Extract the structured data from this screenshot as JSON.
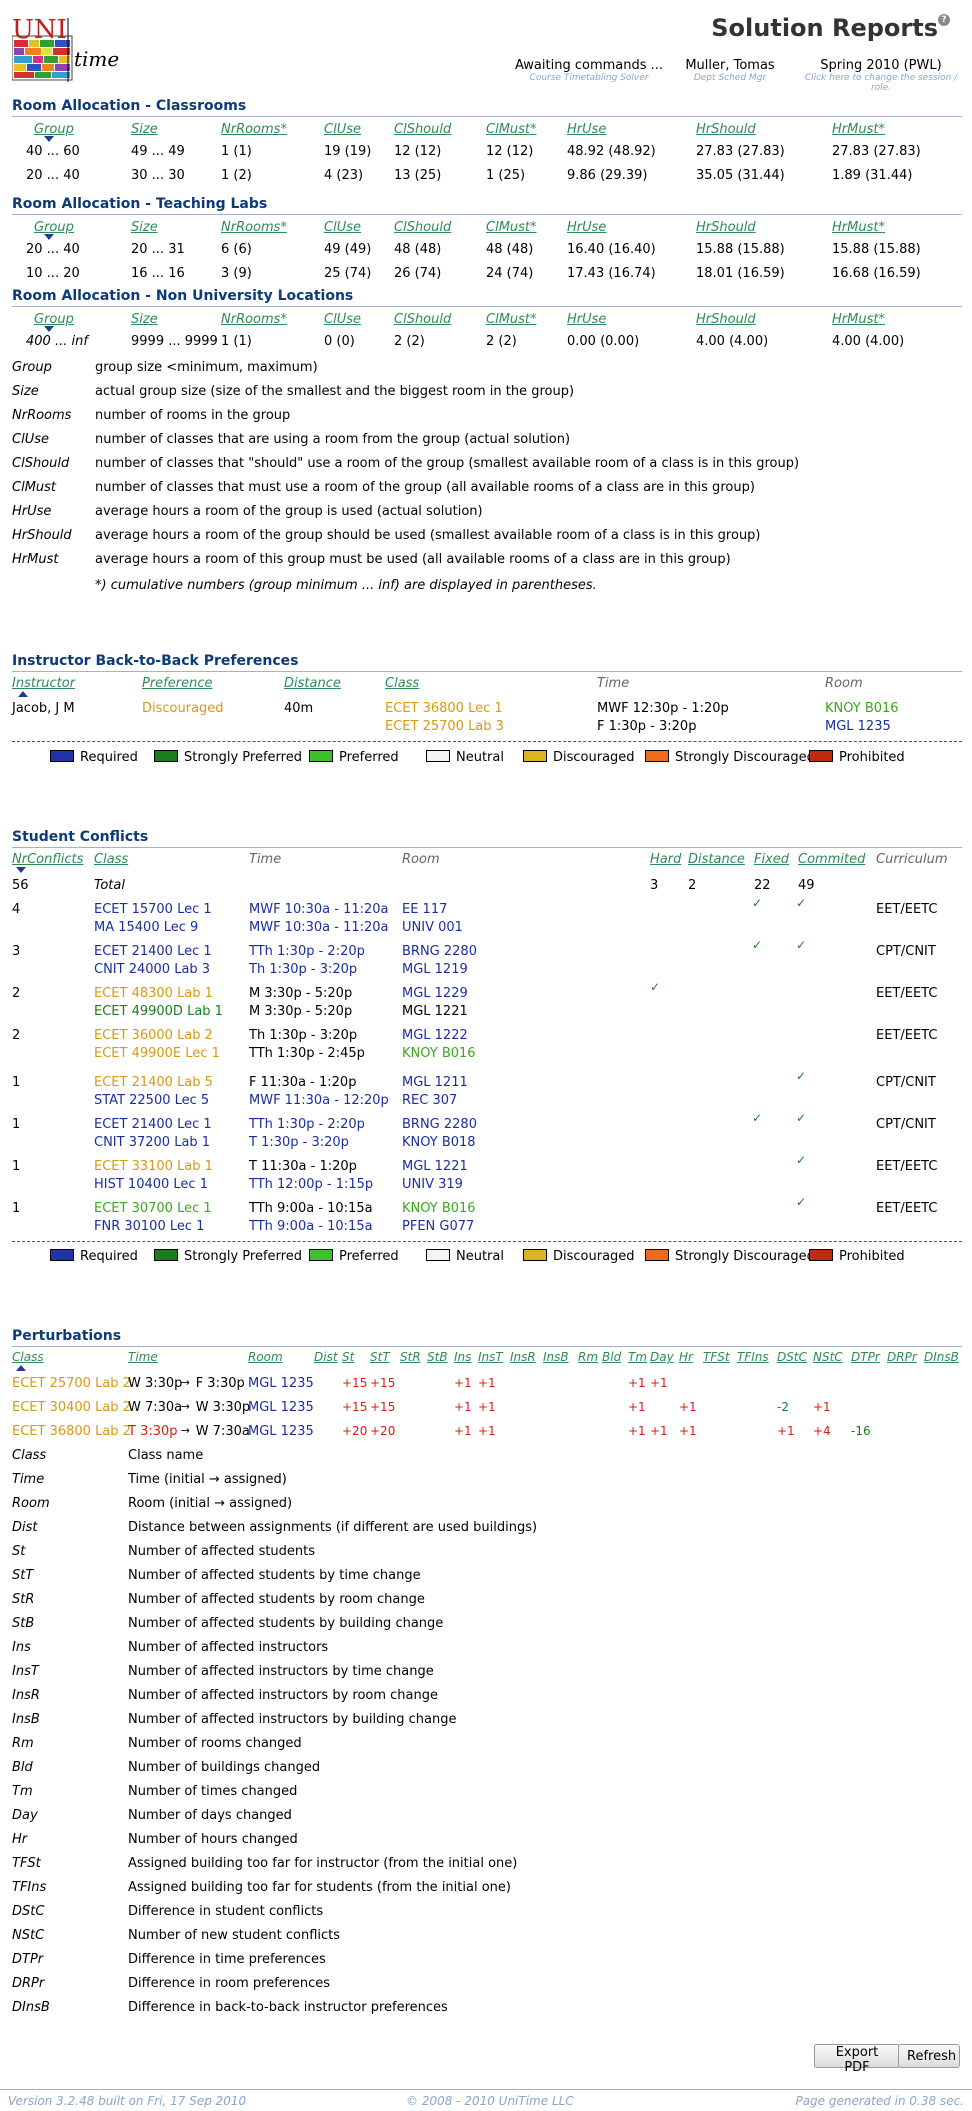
{
  "header": {
    "title": "Solution Reports",
    "logo_text_uni": "UNI",
    "logo_text_time": "time",
    "status": {
      "main": "Awaiting commands ...",
      "sub": "Course Timetabling Solver"
    },
    "user": {
      "main": "Muller, Tomas",
      "sub": "Dept Sched Mgr"
    },
    "session": {
      "main": "Spring 2010 (PWL)",
      "sub": "Click here to change the session / role."
    }
  },
  "room_columns": [
    "Group",
    "Size",
    "NrRooms*",
    "ClUse",
    "ClShould",
    "ClMust*",
    "HrUse",
    "HrShould",
    "HrMust*"
  ],
  "room_sections": [
    {
      "title": "Room Allocation - Classrooms",
      "rows": [
        [
          "40 ... 60",
          "49 ... 49",
          "1 (1)",
          "19 (19)",
          "12 (12)",
          "12 (12)",
          "48.92 (48.92)",
          "27.83 (27.83)",
          "27.83 (27.83)"
        ],
        [
          "20 ... 40",
          "30 ... 30",
          "1 (2)",
          "4 (23)",
          "13 (25)",
          "1 (25)",
          "9.86 (29.39)",
          "35.05 (31.44)",
          "1.89 (31.44)"
        ]
      ]
    },
    {
      "title": "Room Allocation - Teaching Labs",
      "rows": [
        [
          "20 ... 40",
          "20 ... 31",
          "6 (6)",
          "49 (49)",
          "48 (48)",
          "48 (48)",
          "16.40 (16.40)",
          "15.88 (15.88)",
          "15.88 (15.88)"
        ],
        [
          "10 ... 20",
          "16 ... 16",
          "3 (9)",
          "25 (74)",
          "26 (74)",
          "24 (74)",
          "17.43 (16.74)",
          "18.01 (16.59)",
          "16.68 (16.59)"
        ]
      ]
    },
    {
      "title": "Room Allocation - Non University Locations",
      "rows": [
        [
          "400 ... inf",
          "9999 ... 9999",
          "1 (1)",
          "0 (0)",
          "2 (2)",
          "2 (2)",
          "0.00 (0.00)",
          "4.00 (4.00)",
          "4.00 (4.00)"
        ]
      ]
    }
  ],
  "room_legend": [
    [
      "Group",
      "group size <minimum, maximum)"
    ],
    [
      "Size",
      "actual group size (size of the smallest and the biggest room in the group)"
    ],
    [
      "NrRooms",
      "number of rooms in the group"
    ],
    [
      "ClUse",
      "number of classes that are using a room from the group (actual solution)"
    ],
    [
      "ClShould",
      "number of classes that \"should\" use a room of the group (smallest available room of a class is in this group)"
    ],
    [
      "ClMust",
      "number of classes that must use a room of the group (all available rooms of a class are in this group)"
    ],
    [
      "HrUse",
      "average hours a room of the group is used (actual solution)"
    ],
    [
      "HrShould",
      "average hours a room of the group should be used (smallest available room of a class is in this group)"
    ],
    [
      "HrMust",
      "average hours a room of this group must be used (all available rooms of a class are in this group)"
    ]
  ],
  "room_note": "*) cumulative numbers (group minimum ... inf) are displayed in parentheses.",
  "instructor": {
    "title": "Instructor Back-to-Back Preferences",
    "columns": [
      "Instructor",
      "Preference",
      "Distance",
      "Class",
      "Time",
      "Room"
    ],
    "row": {
      "instructor": "Jacob, J M",
      "preference": "Discouraged",
      "distance": "40m",
      "classes": [
        "ECET 36800 Lec 1",
        "ECET 25700 Lab 3"
      ],
      "times": [
        "MWF 12:30p - 1:20p",
        "F 1:30p - 3:20p"
      ],
      "rooms": [
        "KNOY B016",
        "MGL 1235"
      ]
    }
  },
  "pref_legend": [
    {
      "label": "Required",
      "color": "#2233aa"
    },
    {
      "label": "Strongly Preferred",
      "color": "#1c7d1c"
    },
    {
      "label": "Preferred",
      "color": "#3cc02c"
    },
    {
      "label": "Neutral",
      "color": "#f4f4f4"
    },
    {
      "label": "Discouraged",
      "color": "#dcb422"
    },
    {
      "label": "Strongly Discouraged",
      "color": "#ee6a1c"
    },
    {
      "label": "Prohibited",
      "color": "#c02a10"
    }
  ],
  "student": {
    "title": "Student Conflicts",
    "columns": [
      "NrConflicts",
      "Class",
      "Time",
      "Room",
      "Hard",
      "Distance",
      "Fixed",
      "Commited",
      "Curriculum"
    ],
    "total": {
      "nr": "56",
      "label": "Total",
      "hard": "3",
      "distance": "2",
      "fixed": "22",
      "commited": "49"
    },
    "rows": [
      {
        "nr": "4",
        "c1": "ECET 15700 Lec 1",
        "c1c": "blue",
        "c2": "MA 15400 Lec 9",
        "c2c": "blue",
        "t1": "MWF 10:30a - 11:20a",
        "t1c": "blue",
        "t2": "MWF 10:30a - 11:20a",
        "t2c": "blue",
        "r1": "EE 117",
        "r1c": "blue",
        "r2": "UNIV 001",
        "r2c": "blue",
        "hard": "",
        "fixed": "✓",
        "commited": "✓",
        "curr": "EET/EETC"
      },
      {
        "nr": "3",
        "c1": "ECET 21400 Lec 1",
        "c1c": "blue",
        "c2": "CNIT 24000 Lab 3",
        "c2c": "blue",
        "t1": "TTh 1:30p - 2:20p",
        "t1c": "blue",
        "t2": "Th 1:30p - 3:20p",
        "t2c": "blue",
        "r1": "BRNG 2280",
        "r1c": "blue",
        "r2": "MGL 1219",
        "r2c": "blue",
        "hard": "",
        "fixed": "✓",
        "commited": "✓",
        "curr": "CPT/CNIT"
      },
      {
        "nr": "2",
        "c1": "ECET 48300 Lab 1",
        "c1c": "orange",
        "c2": "ECET 49900D Lab 1",
        "c2c": "green",
        "t1": "M 3:30p - 5:20p",
        "t1c": "",
        "t2": "M 3:30p - 5:20p",
        "t2c": "",
        "r1": "MGL 1229",
        "r1c": "blue",
        "r2": "MGL 1221",
        "r2c": "",
        "hard": "✓",
        "fixed": "",
        "commited": "",
        "curr": "EET/EETC"
      },
      {
        "nr": "2",
        "c1": "ECET 36000 Lab 2",
        "c1c": "orange",
        "c2": "ECET 49900E Lec 1",
        "c2c": "orange",
        "t1": "Th 1:30p - 3:20p",
        "t1c": "",
        "t2": "TTh 1:30p - 2:45p",
        "t2c": "",
        "r1": "MGL 1222",
        "r1c": "blue",
        "r2": "KNOY B016",
        "r2c": "lgreen",
        "hard": "",
        "fixed": "",
        "commited": "",
        "curr": "EET/EETC"
      },
      {
        "nr": "1",
        "c1": "ECET 21400 Lab 5",
        "c1c": "orange",
        "c2": "STAT 22500 Lec 5",
        "c2c": "blue",
        "t1": "F 11:30a - 1:20p",
        "t1c": "",
        "t2": "MWF 11:30a - 12:20p",
        "t2c": "blue",
        "r1": "MGL 1211",
        "r1c": "blue",
        "r2": "REC 307",
        "r2c": "blue",
        "hard": "",
        "fixed": "",
        "commited": "✓",
        "curr": "CPT/CNIT"
      },
      {
        "nr": "1",
        "c1": "ECET 21400 Lec 1",
        "c1c": "blue",
        "c2": "CNIT 37200 Lab 1",
        "c2c": "blue",
        "t1": "TTh 1:30p - 2:20p",
        "t1c": "blue",
        "t2": "T 1:30p - 3:20p",
        "t2c": "blue",
        "r1": "BRNG 2280",
        "r1c": "blue",
        "r2": "KNOY B018",
        "r2c": "blue",
        "hard": "",
        "fixed": "✓",
        "commited": "✓",
        "curr": "CPT/CNIT"
      },
      {
        "nr": "1",
        "c1": "ECET 33100 Lab 1",
        "c1c": "orange",
        "c2": "HIST 10400 Lec 1",
        "c2c": "blue",
        "t1": "T 11:30a - 1:20p",
        "t1c": "",
        "t2": "TTh 12:00p - 1:15p",
        "t2c": "blue",
        "r1": "MGL 1221",
        "r1c": "blue",
        "r2": "UNIV 319",
        "r2c": "blue",
        "hard": "",
        "fixed": "",
        "commited": "✓",
        "curr": "EET/EETC"
      },
      {
        "nr": "1",
        "c1": "ECET 30700 Lec 1",
        "c1c": "lgreen",
        "c2": "FNR 30100 Lec 1",
        "c2c": "blue",
        "t1": "TTh 9:00a - 10:15a",
        "t1c": "",
        "t2": "TTh 9:00a - 10:15a",
        "t2c": "blue",
        "r1": "KNOY B016",
        "r1c": "lgreen",
        "r2": "PFEN G077",
        "r2c": "blue",
        "hard": "",
        "fixed": "",
        "commited": "✓",
        "curr": "EET/EETC"
      }
    ]
  },
  "perturb": {
    "title": "Perturbations",
    "columns": [
      "Class",
      "Time",
      "Room",
      "Dist",
      "St",
      "StT",
      "StR",
      "StB",
      "Ins",
      "InsT",
      "InsR",
      "InsB",
      "Rm",
      "Bld",
      "Tm",
      "Day",
      "Hr",
      "TFSt",
      "TFIns",
      "DStC",
      "NStC",
      "DTPr",
      "DRPr",
      "DInsB"
    ],
    "rows": [
      {
        "cls": "ECET 25700 Lab 2",
        "t_from": "W 3:30p",
        "t_from_c": "",
        "t_to": "F 3:30p",
        "room": "MGL 1235",
        "vals": {
          "St": "+15",
          "StT": "+15",
          "Ins": "+1",
          "InsT": "+1",
          "Tm": "+1",
          "Day": "+1"
        }
      },
      {
        "cls": "ECET 30400 Lab 2",
        "t_from": "W 7:30a",
        "t_from_c": "",
        "t_to": "W 3:30p",
        "room": "MGL 1235",
        "vals": {
          "St": "+15",
          "StT": "+15",
          "Ins": "+1",
          "InsT": "+1",
          "Tm": "+1",
          "Hr": "+1",
          "DStC": "-2",
          "NStC": "+1"
        }
      },
      {
        "cls": "ECET 36800 Lab 2",
        "t_from": "T 3:30p",
        "t_from_c": "red",
        "t_to": "W 7:30a",
        "room": "MGL 1235",
        "vals": {
          "St": "+20",
          "StT": "+20",
          "Ins": "+1",
          "InsT": "+1",
          "Tm": "+1",
          "Day": "+1",
          "Hr": "+1",
          "DStC": "+1",
          "NStC": "+4",
          "DTPr": "-16"
        }
      }
    ],
    "arrow": "→",
    "legend": [
      [
        "Class",
        "Class name"
      ],
      [
        "Time",
        "Time (initial → assigned)"
      ],
      [
        "Room",
        "Room (initial → assigned)"
      ],
      [
        "Dist",
        "Distance between assignments (if different are used buildings)"
      ],
      [
        "St",
        "Number of affected students"
      ],
      [
        "StT",
        "Number of affected students by time change"
      ],
      [
        "StR",
        "Number of affected students by room change"
      ],
      [
        "StB",
        "Number of affected students by building change"
      ],
      [
        "Ins",
        "Number of affected instructors"
      ],
      [
        "InsT",
        "Number of affected instructors by time change"
      ],
      [
        "InsR",
        "Number of affected instructors by room change"
      ],
      [
        "InsB",
        "Number of affected instructors by building change"
      ],
      [
        "Rm",
        "Number of rooms changed"
      ],
      [
        "Bld",
        "Number of buildings changed"
      ],
      [
        "Tm",
        "Number of times changed"
      ],
      [
        "Day",
        "Number of days changed"
      ],
      [
        "Hr",
        "Number of hours changed"
      ],
      [
        "TFSt",
        "Assigned building too far for instructor (from the initial one)"
      ],
      [
        "TFIns",
        "Assigned building too far for students (from the initial one)"
      ],
      [
        "DStC",
        "Difference in student conflicts"
      ],
      [
        "NStC",
        "Number of new student conflicts"
      ],
      [
        "DTPr",
        "Difference in time preferences"
      ],
      [
        "DRPr",
        "Difference in room preferences"
      ],
      [
        "DInsB",
        "Difference in back-to-back instructor preferences"
      ]
    ]
  },
  "buttons": {
    "export": "Export PDF",
    "refresh": "Refresh"
  },
  "footer": {
    "version": "Version 3.2.48 built on Fri, 17 Sep 2010",
    "copyright": "© 2008 - 2010 UniTime LLC",
    "generated": "Page generated in 0.38 sec."
  }
}
